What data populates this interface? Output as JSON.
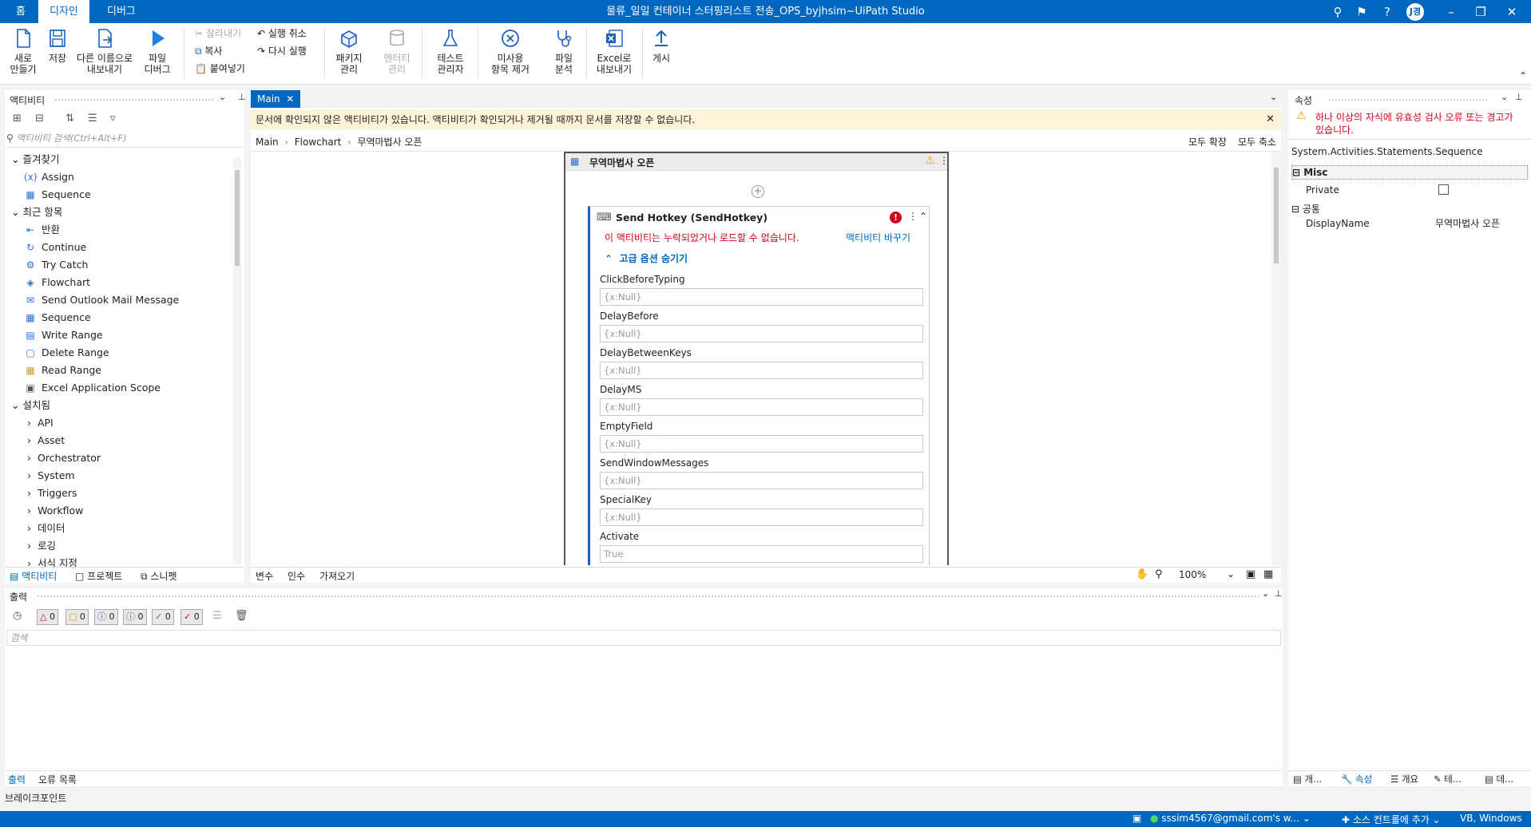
{
  "titlebar": {
    "tabs": [
      "홈",
      "디자인",
      "디버그"
    ],
    "title": "물류_일일 컨테이너 스터핑리스트 전송_OPS_byjhsim~UiPath Studio",
    "avatar": "J경"
  },
  "ribbon": {
    "new": [
      "새로",
      "만들기"
    ],
    "save": "저장",
    "export": [
      "다른 이름으로",
      "내보내기"
    ],
    "debug": [
      "파일",
      "디버그"
    ],
    "cut": "잘라내기",
    "copy": "복사",
    "paste": "붙여넣기",
    "undo": "실행 취소",
    "redo": "다시 실행",
    "packages": [
      "패키지",
      "관리"
    ],
    "entities": [
      "엔터티",
      "관리"
    ],
    "test": [
      "테스트",
      "관리자"
    ],
    "remove_unused": [
      "미사용",
      "항목 제거"
    ],
    "analyze": [
      "파일",
      "분석"
    ],
    "excel": [
      "Excel로",
      "내보내기"
    ],
    "publish": "게시"
  },
  "activities": {
    "title": "액티비티",
    "search_placeholder": "액티비티 검색(Ctrl+Alt+F)",
    "favorites_label": "즐겨찾기",
    "favorites": [
      "Assign",
      "Sequence"
    ],
    "recent_label": "최근 항목",
    "recent": [
      "반환",
      "Continue",
      "Try Catch",
      "Flowchart",
      "Send Outlook Mail Message",
      "Sequence",
      "Write Range",
      "Delete Range",
      "Read Range",
      "Excel Application Scope"
    ],
    "installed_label": "설치됨",
    "installed": [
      "API",
      "Asset",
      "Orchestrator",
      "System",
      "Triggers",
      "Workflow",
      "데이터",
      "로깅",
      "서식 지정"
    ],
    "bottom_tabs": [
      "액티비티",
      "프로젝트",
      "스니펫"
    ]
  },
  "designer": {
    "tab": "Main",
    "warning": "문서에 확인되지 않은 액티비티가 있습니다. 액티비티가 확인되거나 제거될 때까지 문서를 저장할 수 없습니다.",
    "breadcrumb": [
      "Main",
      "Flowchart",
      "무역마법사 오픈"
    ],
    "expand_all": "모두 확장",
    "collapse_all": "모두 축소",
    "sequence_title": "무역마법사 오픈",
    "activity_title": "Send Hotkey (SendHotkey)",
    "error_text": "이 액티비티는 누락되었거나 로드할 수 없습니다.",
    "replace_link": "액티비티 바꾸기",
    "advanced_toggle": "고급 옵션 숨기기",
    "fields": [
      {
        "label": "ClickBeforeTyping",
        "value": "{x:Null}"
      },
      {
        "label": "DelayBefore",
        "value": "{x:Null}"
      },
      {
        "label": "DelayBetweenKeys",
        "value": "{x:Null}"
      },
      {
        "label": "DelayMS",
        "value": "{x:Null}"
      },
      {
        "label": "EmptyField",
        "value": "{x:Null}"
      },
      {
        "label": "SendWindowMessages",
        "value": "{x:Null}"
      },
      {
        "label": "SpecialKey",
        "value": "{x:Null}"
      },
      {
        "label": "Activate",
        "value": "True"
      }
    ],
    "bottom_tabs": [
      "변수",
      "인수",
      "가져오기"
    ],
    "zoom": "100%"
  },
  "properties": {
    "title": "속성",
    "error": "하나 이상의 자식에 유효성 검사 오류 또는 경고가 있습니다.",
    "type": "System.Activities.Statements.Sequence",
    "misc_label": "Misc",
    "private_label": "Private",
    "common_label": "공통",
    "displayname_label": "DisplayName",
    "displayname_value": "무역마법사 오픈",
    "bottom_tabs": [
      "개...",
      "속성",
      "개요",
      "테...",
      "데..."
    ]
  },
  "output": {
    "title": "출력",
    "counts": [
      "0",
      "0",
      "0",
      "0",
      "0",
      "0"
    ],
    "search_placeholder": "검색",
    "bottom_tabs": [
      "출력",
      "오류 목록"
    ],
    "breakpoints": "브레이크포인트"
  },
  "statusbar": {
    "account": "sssim4567@gmail.com's w...",
    "source_control": "소스 컨트롤에 추가",
    "language": "VB, Windows"
  },
  "colors": {
    "accent": "#0067c0",
    "error": "#d0021b",
    "warning_bg": "#fdf3d8"
  }
}
